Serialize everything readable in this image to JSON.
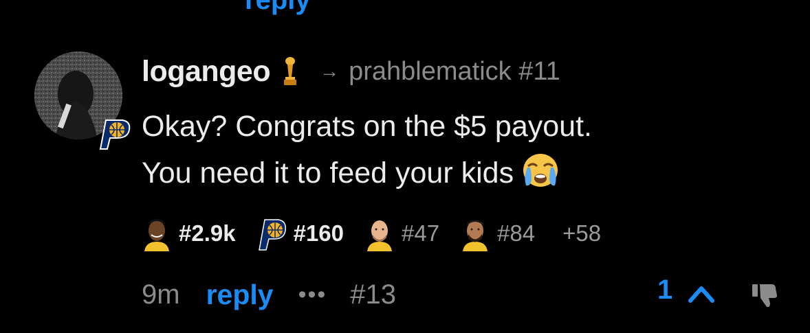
{
  "comment": {
    "username": "logangeo",
    "reply_to": "prahblematick #11",
    "text_line1": "Okay? Congrats on the $5 payout.",
    "text_line2": "You need it to feed your kids",
    "avatar_icon": "user-avatar-photo",
    "team_icon": "indiana-pacers-logo",
    "flair_icon": "trophy-icon"
  },
  "badges": [
    {
      "icon": "player-face-1",
      "label": "#2.9k"
    },
    {
      "icon": "pacers-logo",
      "label": "#160"
    },
    {
      "icon": "player-face-2",
      "label": "#47"
    },
    {
      "icon": "player-face-3",
      "label": "#84"
    }
  ],
  "badges_more": "+58",
  "footer": {
    "time": "9m",
    "reply_label": "reply",
    "more_label": "•••",
    "comment_number": "#13",
    "vote_count": "1"
  },
  "prev_reply_label": "reply",
  "colors": {
    "background": "#000000",
    "accent": "#1a8cf5",
    "text": "#ececec",
    "muted": "#8b8b8b"
  }
}
